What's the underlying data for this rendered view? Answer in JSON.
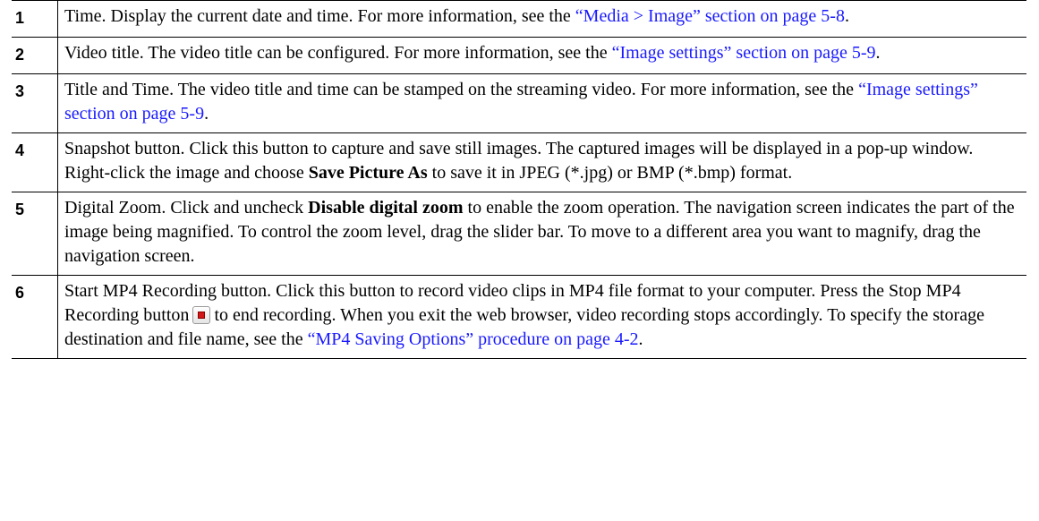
{
  "rows": [
    {
      "num": "1",
      "text_a": "Time. Display the current date and time. For more information, see the ",
      "link": "“Media > Image” section on page 5-8",
      "text_b": "."
    },
    {
      "num": "2",
      "text_a": "Video title. The video title can be configured. For more information, see the ",
      "link": "“Image settings” section on page 5-9",
      "text_b": "."
    },
    {
      "num": "3",
      "text_a": "Title and Time. The video title and time can be stamped on the streaming video. For more information, see the ",
      "link": "“Image settings” section on page 5-9",
      "text_b": "."
    },
    {
      "num": "4",
      "text_a": "Snapshot button. Click this button to capture and save still images. The captured images will be displayed in a pop-up window. Right-click the image and choose ",
      "bold": "Save Picture As",
      "text_b": " to save it in JPEG (*.jpg) or BMP (*.bmp) format."
    },
    {
      "num": "5",
      "text_a": "Digital Zoom. Click and uncheck ",
      "bold": "Disable digital zoom",
      "text_b": " to enable the zoom operation. The navigation screen indicates the part of the image being magnified. To control the zoom level, drag the slider bar. To move to a different area you want to magnify, drag the navigation screen."
    },
    {
      "num": "6",
      "text_a": "Start MP4 Recording button. Click this button to record video clips in MP4 file format to your computer. Press the Stop MP4 Recording button",
      "icon": "stop-recording-icon",
      "text_b": "to end recording. When you exit the web browser, video recording stops accordingly. To specify the storage destination and file name, see the ",
      "link": "“MP4 Saving Options” procedure on page 4-2",
      "text_c": "."
    }
  ]
}
